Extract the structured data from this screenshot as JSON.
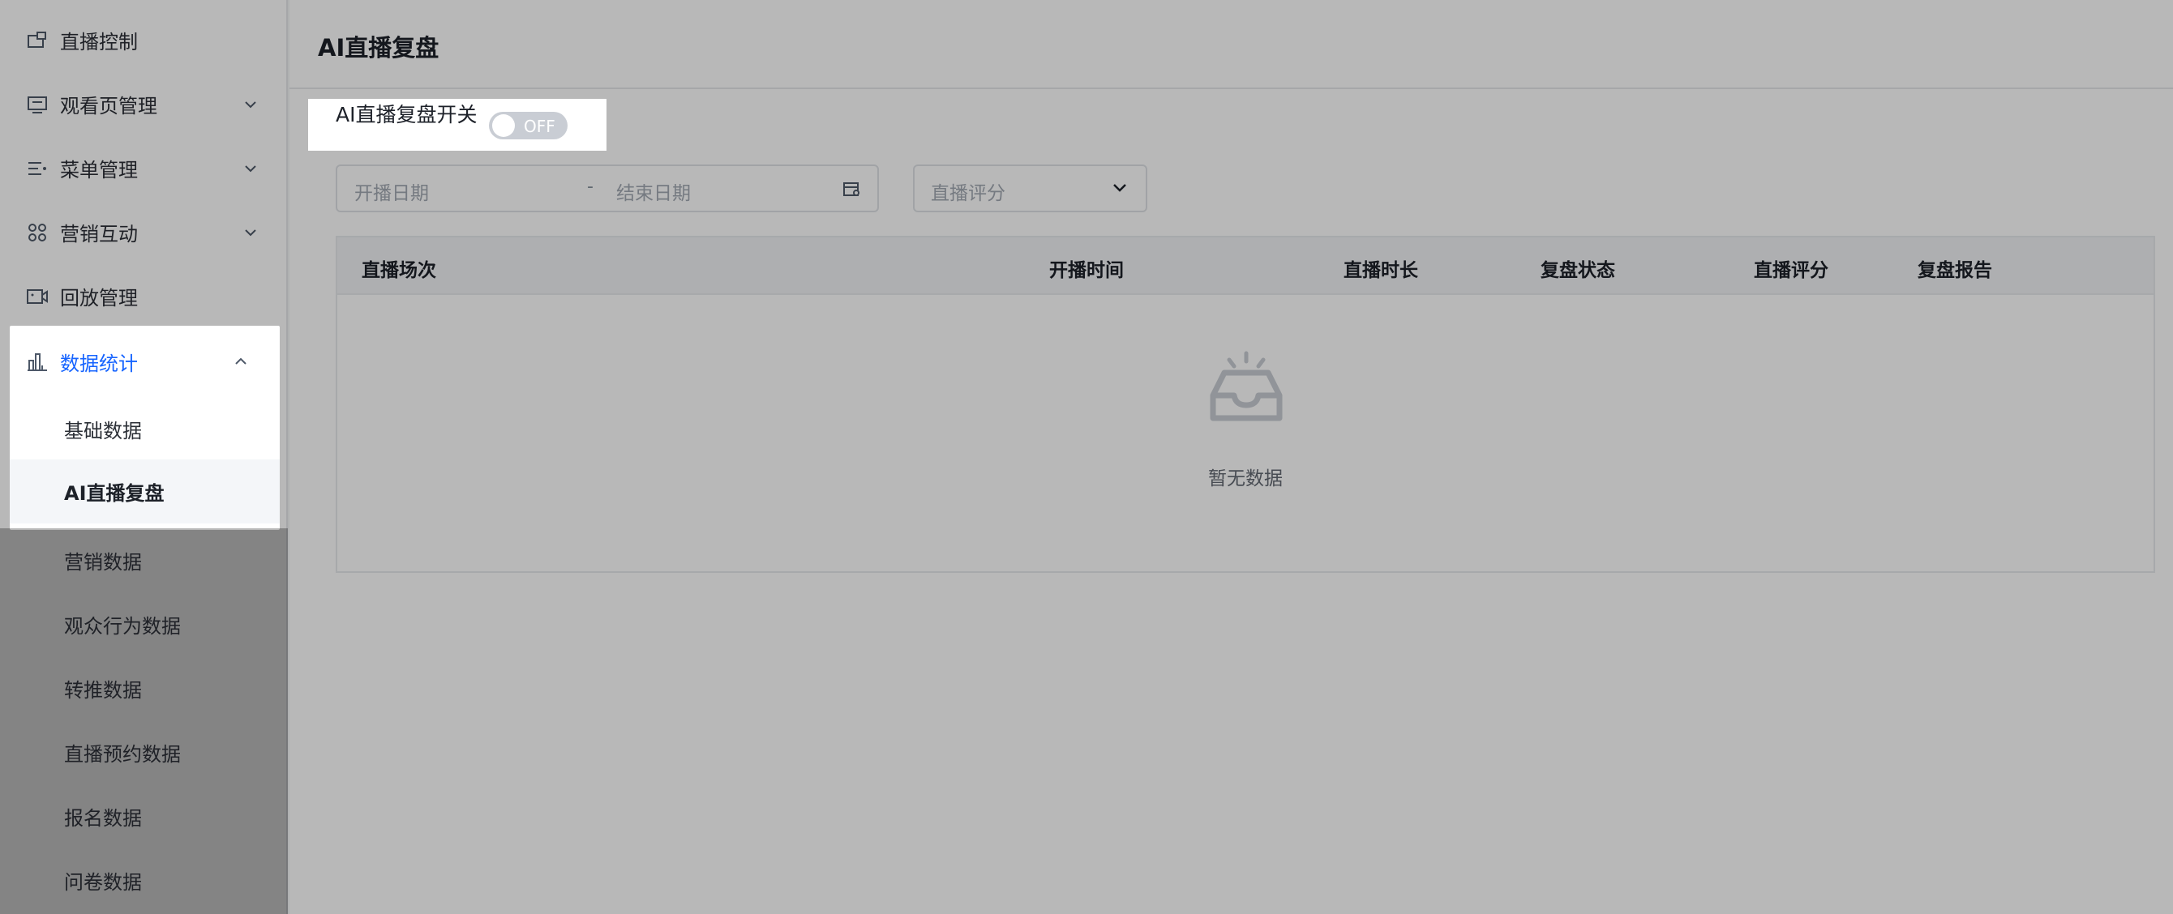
{
  "sidebar": {
    "items": [
      {
        "label": "直播控制",
        "icon": "screen-icon"
      },
      {
        "label": "观看页管理",
        "icon": "monitor-icon"
      },
      {
        "label": "菜单管理",
        "icon": "menu-list-icon"
      },
      {
        "label": "营销互动",
        "icon": "grid-icon"
      },
      {
        "label": "回放管理",
        "icon": "video-icon"
      },
      {
        "label": "数据统计",
        "icon": "bar-chart-icon"
      }
    ],
    "sub_items": [
      {
        "label": "基础数据"
      },
      {
        "label": "AI直播复盘"
      },
      {
        "label": "营销数据"
      },
      {
        "label": "观众行为数据"
      },
      {
        "label": "转推数据"
      },
      {
        "label": "直播预约数据"
      },
      {
        "label": "报名数据"
      },
      {
        "label": "问卷数据"
      }
    ]
  },
  "header": {
    "title": "AI直播复盘"
  },
  "switch": {
    "label": "AI直播复盘开关",
    "state_text": "OFF"
  },
  "filters": {
    "start_placeholder": "开播日期",
    "separator": "-",
    "end_placeholder": "结束日期",
    "rating_placeholder": "直播评分"
  },
  "table": {
    "columns": [
      "直播场次",
      "开播时间",
      "直播时长",
      "复盘状态",
      "直播评分",
      "复盘报告"
    ],
    "empty_text": "暂无数据"
  },
  "colors": {
    "accent": "#1664ff",
    "toggle_off": "#c9cdd4"
  }
}
